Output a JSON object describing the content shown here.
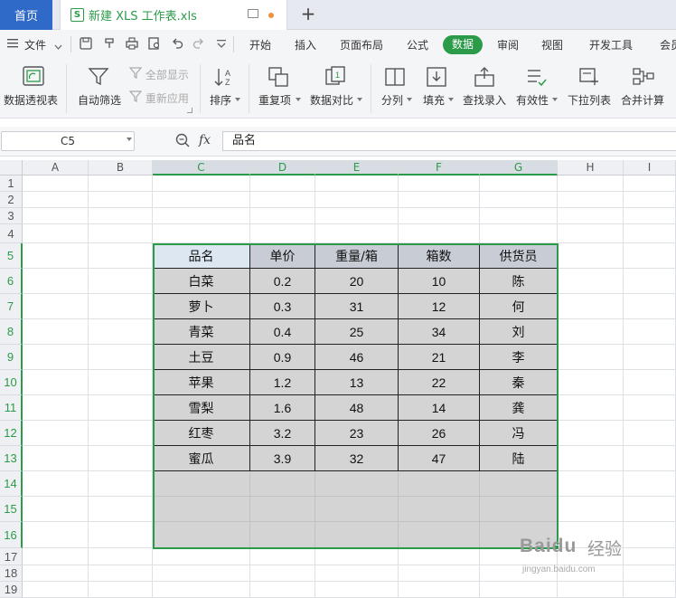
{
  "titlebar": {
    "home_tab": "首页",
    "doc_icon": "S",
    "doc_title": "新建 XLS 工作表.xls",
    "add_tab": "+"
  },
  "menu": {
    "file": "文件",
    "items": [
      "开始",
      "插入",
      "页面布局",
      "公式",
      "数据",
      "审阅",
      "视图",
      "开发工具",
      "会员"
    ],
    "active": "数据"
  },
  "ribbon": {
    "pivot": "数据透视表",
    "autofilter": "自动筛选",
    "show_all": "全部显示",
    "reapply": "重新应用",
    "sort": "排序",
    "duplicates": "重复项",
    "compare": "数据对比",
    "split": "分列",
    "fill": "填充",
    "lookup": "查找录入",
    "validity": "有效性",
    "dropdown": "下拉列表",
    "consolidate": "合并计算"
  },
  "formula_bar": {
    "name_box": "C5",
    "fx": "fx",
    "content": "品名"
  },
  "grid": {
    "columns": [
      "A",
      "B",
      "C",
      "D",
      "E",
      "F",
      "G",
      "H",
      "I"
    ],
    "rows": [
      "1",
      "2",
      "3",
      "4",
      "5",
      "6",
      "7",
      "8",
      "9",
      "10",
      "11",
      "12",
      "13",
      "14",
      "15",
      "16",
      "17",
      "18",
      "19"
    ]
  },
  "table": {
    "headers": [
      "品名",
      "单价",
      "重量/箱",
      "箱数",
      "供货员"
    ],
    "rows": [
      [
        "白菜",
        "0.2",
        "20",
        "10",
        "陈"
      ],
      [
        "萝卜",
        "0.3",
        "31",
        "12",
        "何"
      ],
      [
        "青菜",
        "0.4",
        "25",
        "34",
        "刘"
      ],
      [
        "土豆",
        "0.9",
        "46",
        "21",
        "李"
      ],
      [
        "苹果",
        "1.2",
        "13",
        "22",
        "秦"
      ],
      [
        "雪梨",
        "1.6",
        "48",
        "14",
        "龚"
      ],
      [
        "红枣",
        "3.2",
        "23",
        "26",
        "冯"
      ],
      [
        "蜜瓜",
        "3.9",
        "32",
        "47",
        "陆"
      ]
    ]
  },
  "watermark": {
    "logo": "Baidu",
    "text": "经验",
    "url": "jingyan.baidu.com"
  },
  "colors": {
    "accent_green": "#2b9a49",
    "home_tab_blue": "#2f6ac8",
    "table_fill": "#d4d4d4",
    "header_fill": "#c8cdd5"
  }
}
